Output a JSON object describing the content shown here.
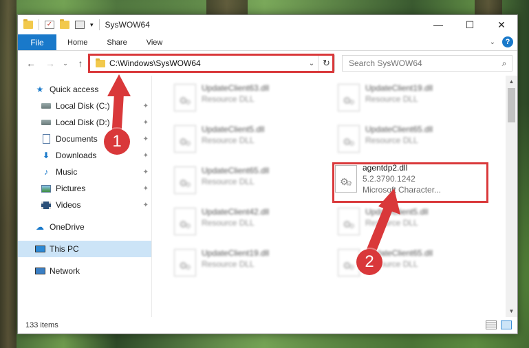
{
  "titlebar": {
    "title": "SysWOW64",
    "qa_dropdown": "▾",
    "minimize": "—",
    "maximize": "☐",
    "close": "✕"
  },
  "ribbon": {
    "tabs": [
      {
        "label": "File"
      },
      {
        "label": "Home"
      },
      {
        "label": "Share"
      },
      {
        "label": "View"
      }
    ],
    "collapse_glyph": "⌄",
    "help_glyph": "?"
  },
  "nav": {
    "back": "←",
    "forward": "→",
    "recent": "⌄",
    "up": "↑",
    "address": "C:\\Windows\\SysWOW64",
    "address_dropdown": "⌄",
    "refresh": "↻",
    "search_placeholder": "Search SysWOW64",
    "search_icon": "⌕"
  },
  "sidebar": {
    "items": [
      {
        "label": "Quick access",
        "icon": "star-icon",
        "pinned": false
      },
      {
        "label": "Local Disk (C:)",
        "icon": "disk-icon",
        "pinned": true
      },
      {
        "label": "Local Disk (D:)",
        "icon": "disk-icon",
        "pinned": true
      },
      {
        "label": "Documents",
        "icon": "document-icon",
        "pinned": true
      },
      {
        "label": "Downloads",
        "icon": "download-icon",
        "pinned": true
      },
      {
        "label": "Music",
        "icon": "music-icon",
        "pinned": true
      },
      {
        "label": "Pictures",
        "icon": "pictures-icon",
        "pinned": true
      },
      {
        "label": "Videos",
        "icon": "videos-icon",
        "pinned": true
      },
      {
        "label": "OneDrive",
        "icon": "onedrive-icon",
        "pinned": false
      },
      {
        "label": "This PC",
        "icon": "pc-icon",
        "pinned": false,
        "selected": true
      },
      {
        "label": "Network",
        "icon": "network-icon",
        "pinned": false
      }
    ],
    "pin_glyph": "📌"
  },
  "files": {
    "left_column": [
      {
        "name": "UpdateClient63.dll",
        "subtitle": "Resource DLL"
      },
      {
        "name": "UpdateClient5.dll",
        "subtitle": "Resource DLL"
      },
      {
        "name": "UpdateClient65.dll",
        "subtitle": "Resource DLL"
      },
      {
        "name": "UpdateClient42.dll",
        "subtitle": "Resource DLL"
      },
      {
        "name": "UpdateClient19.dll",
        "subtitle": "Resource DLL"
      }
    ],
    "right_column": [
      {
        "name": "UpdateClient19.dll",
        "subtitle": "Resource DLL"
      },
      {
        "name": "UpdateClient65.dll",
        "subtitle": "Resource DLL"
      },
      {
        "name": "agentdp2.dll",
        "version": "5.2.3790.1242",
        "description": "Microsoft Character..."
      },
      {
        "name": "UpdateClient5.dll",
        "subtitle": "Resource DLL"
      },
      {
        "name": "UpdateClient65.dll",
        "subtitle": "Resource DLL"
      }
    ]
  },
  "status": {
    "item_count": "133 items"
  },
  "annotations": {
    "step1": "1",
    "step2": "2",
    "highlight_color": "#d9383a"
  }
}
